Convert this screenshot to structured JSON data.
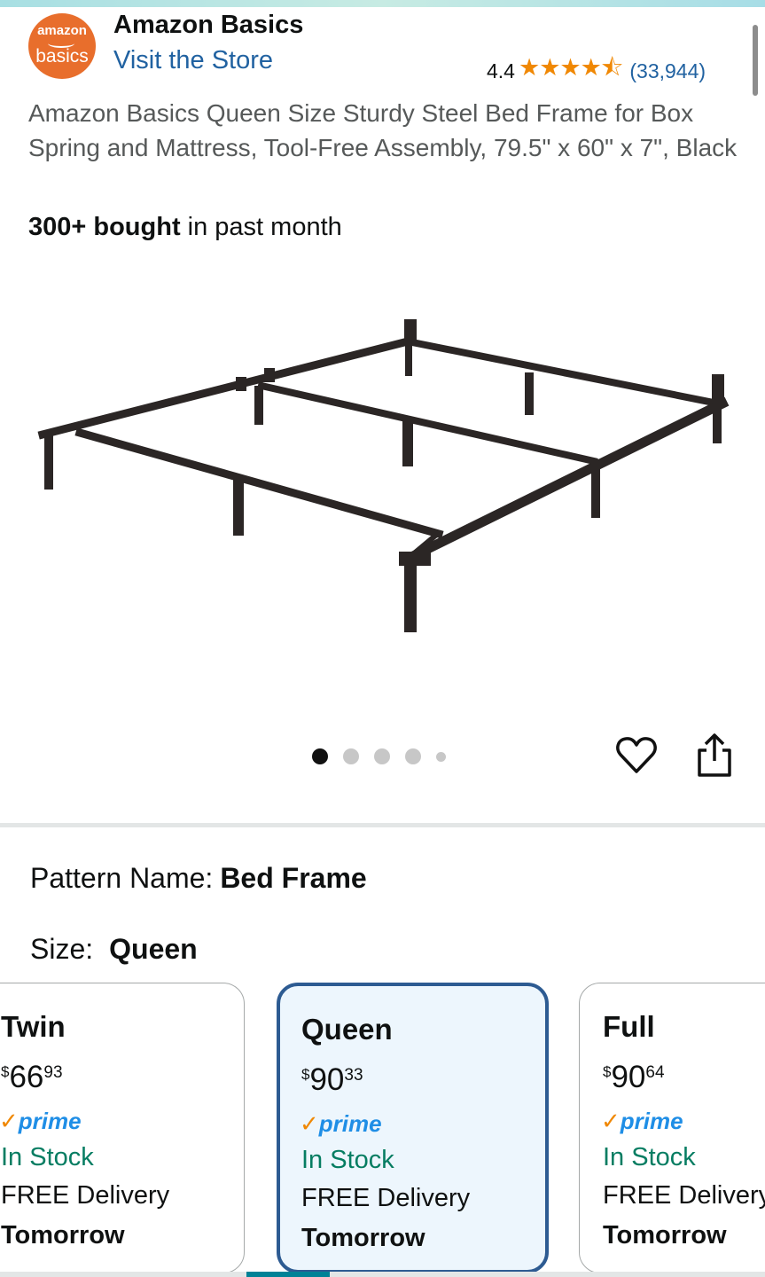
{
  "brand": {
    "logo_line1": "amazon",
    "logo_line2": "basics",
    "name": "Amazon Basics",
    "store_link": "Visit the Store"
  },
  "rating": {
    "value": "4.4",
    "stars": "★★★★⯪",
    "stars_value": 4.4,
    "count": "(33,944)"
  },
  "product": {
    "title": "Amazon Basics Queen Size Sturdy Steel Bed Frame for Box Spring and Mattress, Tool-Free Assembly, 79.5\" x 60\" x 7\", Black",
    "bought_bold": "300+ bought",
    "bought_rest": " in past month",
    "image_alt": "black steel bed frame"
  },
  "carousel": {
    "total": 5,
    "active": 1
  },
  "selections": {
    "pattern_label": "Pattern Name:",
    "pattern_value": "Bed Frame",
    "size_label": "Size:",
    "size_value": "Queen"
  },
  "sizes": [
    {
      "name": "Twin",
      "currency": "$",
      "dollars": "66",
      "cents": "93",
      "prime": "prime",
      "stock": "In Stock",
      "delivery": "FREE Delivery",
      "when": "Tomorrow",
      "selected": false
    },
    {
      "name": "Queen",
      "currency": "$",
      "dollars": "90",
      "cents": "33",
      "prime": "prime",
      "stock": "In Stock",
      "delivery": "FREE Delivery",
      "when": "Tomorrow",
      "selected": true
    },
    {
      "name": "Full",
      "currency": "$",
      "dollars": "90",
      "cents": "64",
      "prime": "prime",
      "stock": "In Stock",
      "delivery": "FREE Delivery",
      "when": "Tomorrow",
      "selected": false
    }
  ],
  "colors": {
    "link": "#2162a1",
    "star": "#f08804",
    "in_stock": "#067d62",
    "prime": "#1f8ee6",
    "selected_border": "#2d5b92",
    "brand_orange": "#e86e2c"
  }
}
